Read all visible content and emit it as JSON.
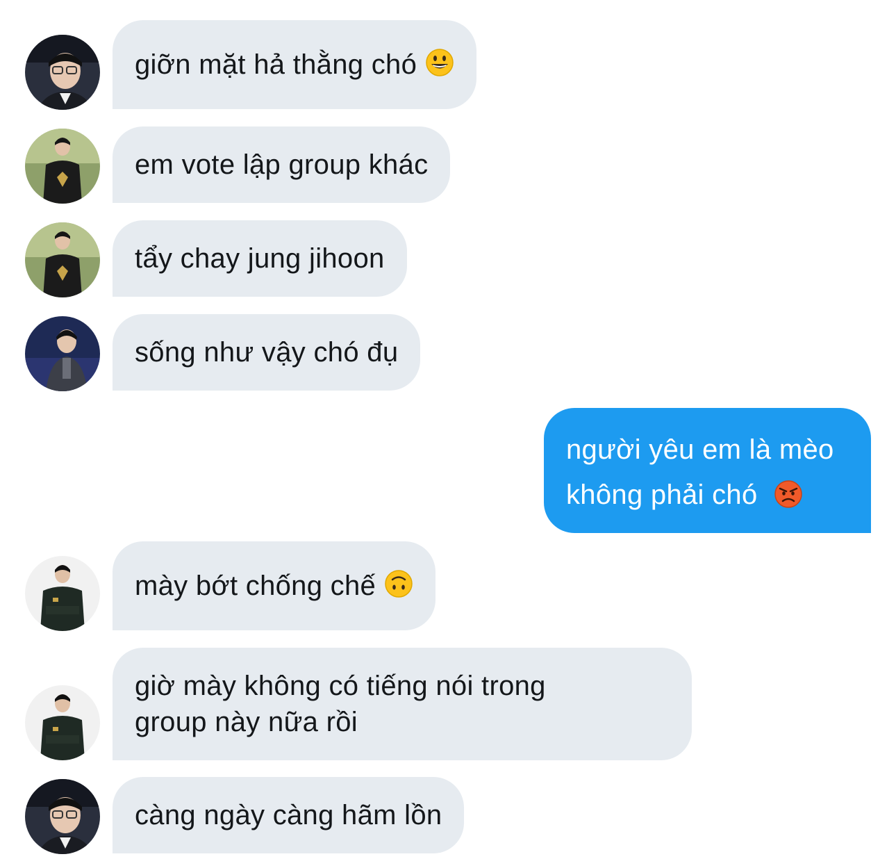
{
  "conversation": {
    "messages": [
      {
        "direction": "in",
        "avatar": "avatar-glasses-man",
        "text": "giỡn mặt hả thằng chó",
        "emoji": "grinning-face-emoji"
      },
      {
        "direction": "in",
        "avatar": "avatar-jersey-man",
        "text": "em vote lập group khác"
      },
      {
        "direction": "in",
        "avatar": "avatar-jersey-man",
        "text": "tẩy chay jung jihoon"
      },
      {
        "direction": "in",
        "avatar": "avatar-suit-man",
        "text": "sống như vậy chó đụ"
      },
      {
        "direction": "out",
        "lines": [
          "người yêu em là mèo",
          "không phải chó"
        ],
        "emoji": "angry-face-emoji"
      },
      {
        "direction": "in",
        "avatar": "avatar-jacket-man",
        "text": "mày bớt chống chế",
        "emoji": "upside-down-face-emoji"
      },
      {
        "direction": "in",
        "avatar": "avatar-jacket-man",
        "lines": [
          "giờ mày không có tiếng nói trong",
          "group này nữa rồi"
        ]
      },
      {
        "direction": "in",
        "avatar": "avatar-glasses-man",
        "text": "càng ngày càng hãm lồn"
      }
    ]
  },
  "colors": {
    "incoming_bubble": "#e6ebf0",
    "outgoing_bubble": "#1d9bf0",
    "incoming_text": "#14171a",
    "outgoing_text": "#ffffff"
  }
}
